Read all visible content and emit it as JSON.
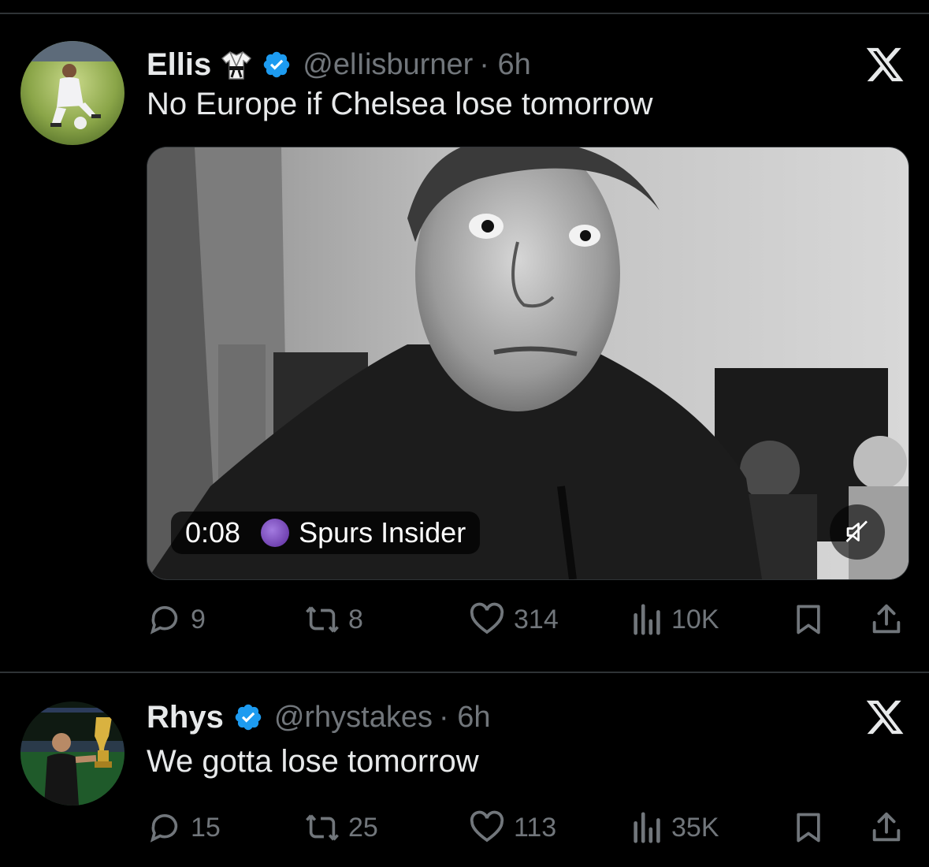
{
  "tweets": [
    {
      "name": "Ellis",
      "emoji_icon": "martial-arts-uniform-icon",
      "verified": true,
      "handle": "@elIisburner",
      "time": "· 6h",
      "text": "No Europe if Chelsea lose tomorrow",
      "media": {
        "type": "video",
        "duration": "0:08",
        "source": "Spurs Insider",
        "muted": true
      },
      "stats": {
        "replies": "9",
        "reposts": "8",
        "likes": "314",
        "views": "10K"
      }
    },
    {
      "name": "Rhys",
      "verified": true,
      "handle": "@rhystakes",
      "time": "· 6h",
      "text": "We gotta lose tomorrow",
      "stats": {
        "replies": "15",
        "reposts": "25",
        "likes": "113",
        "views": "35K"
      }
    }
  ],
  "colors": {
    "background": "#000000",
    "text": "#e7e9ea",
    "muted": "#71767b",
    "verified": "#1d9bf0",
    "divider": "#2f3336"
  }
}
